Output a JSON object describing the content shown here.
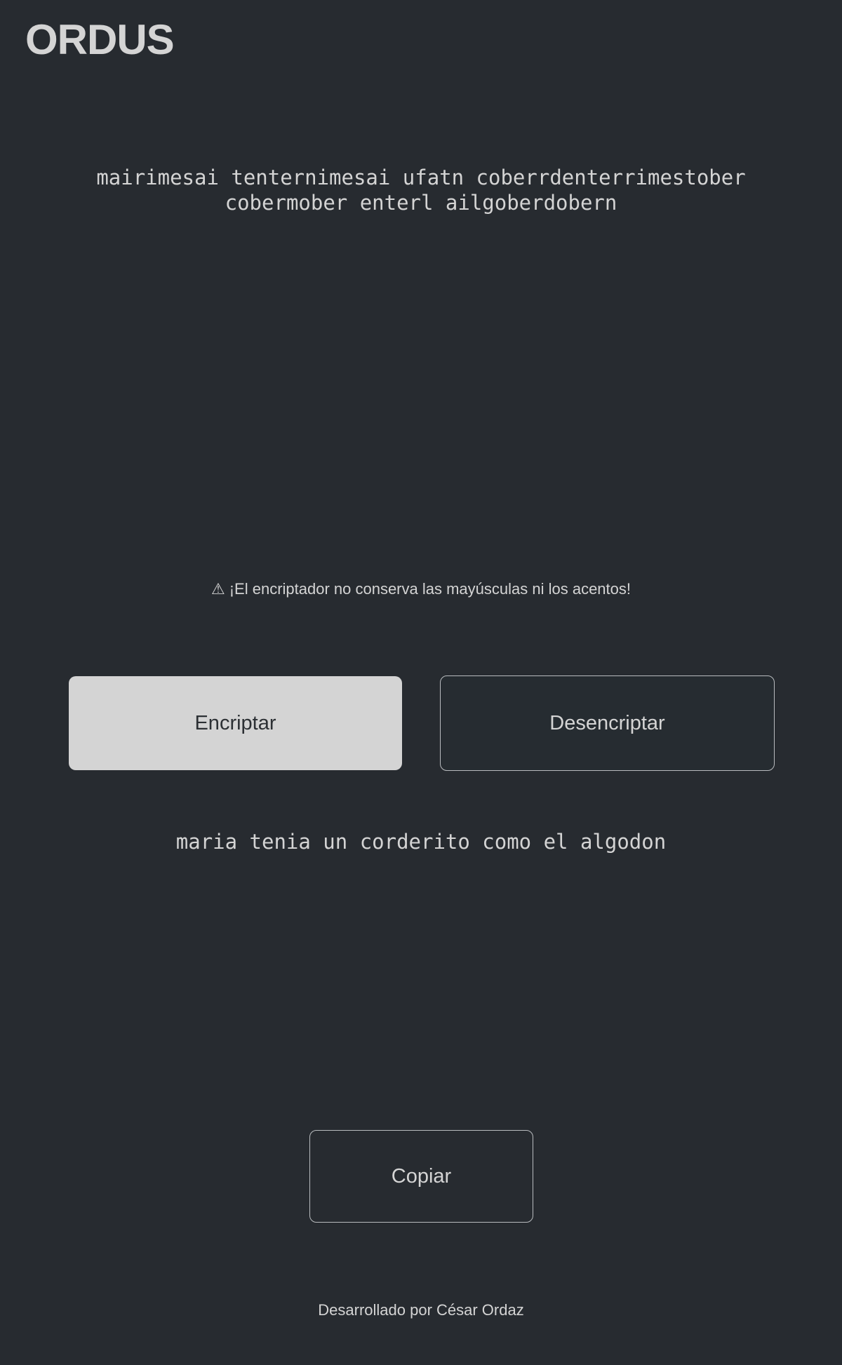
{
  "header": {
    "brand": "ORDUS"
  },
  "input": {
    "value": "mairimesai tenternimesai ufatn coberrdenterrimestober cobermober enterl ailgoberdobern"
  },
  "warning": {
    "icon": "warning-icon",
    "icon_glyph": "⚠",
    "text": "¡El encriptador no conserva las mayúsculas ni los acentos!"
  },
  "actions": {
    "encrypt_label": "Encriptar",
    "decrypt_label": "Desencriptar"
  },
  "output": {
    "text": "maria tenia un corderito como el algodon",
    "copy_label": "Copiar"
  },
  "footer": {
    "text": "Desarrollado por César Ordaz"
  },
  "colors": {
    "background": "#272b30",
    "text": "#d4d4d4",
    "primary_button_bg": "#d4d4d4",
    "outline_border": "#b9bcbf"
  }
}
